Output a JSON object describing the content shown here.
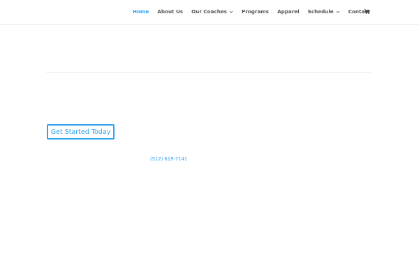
{
  "nav": {
    "items": [
      {
        "label": "Home",
        "active": true,
        "dropdown": false
      },
      {
        "label": "About Us",
        "active": false,
        "dropdown": false
      },
      {
        "label": "Our Coaches",
        "active": false,
        "dropdown": true
      },
      {
        "label": "Programs",
        "active": false,
        "dropdown": false
      },
      {
        "label": "Apparel",
        "active": false,
        "dropdown": false
      },
      {
        "label": "Schedule",
        "active": false,
        "dropdown": true
      },
      {
        "label": "Contact",
        "active": false,
        "dropdown": false
      }
    ],
    "cart_icon": "shopping-cart-icon"
  },
  "main": {
    "cta_label": "Get Started Today",
    "phone": "(512) 619-7141"
  },
  "colors": {
    "accent": "#2ea3f2",
    "nav_text": "#555555",
    "divider": "#ececec"
  }
}
